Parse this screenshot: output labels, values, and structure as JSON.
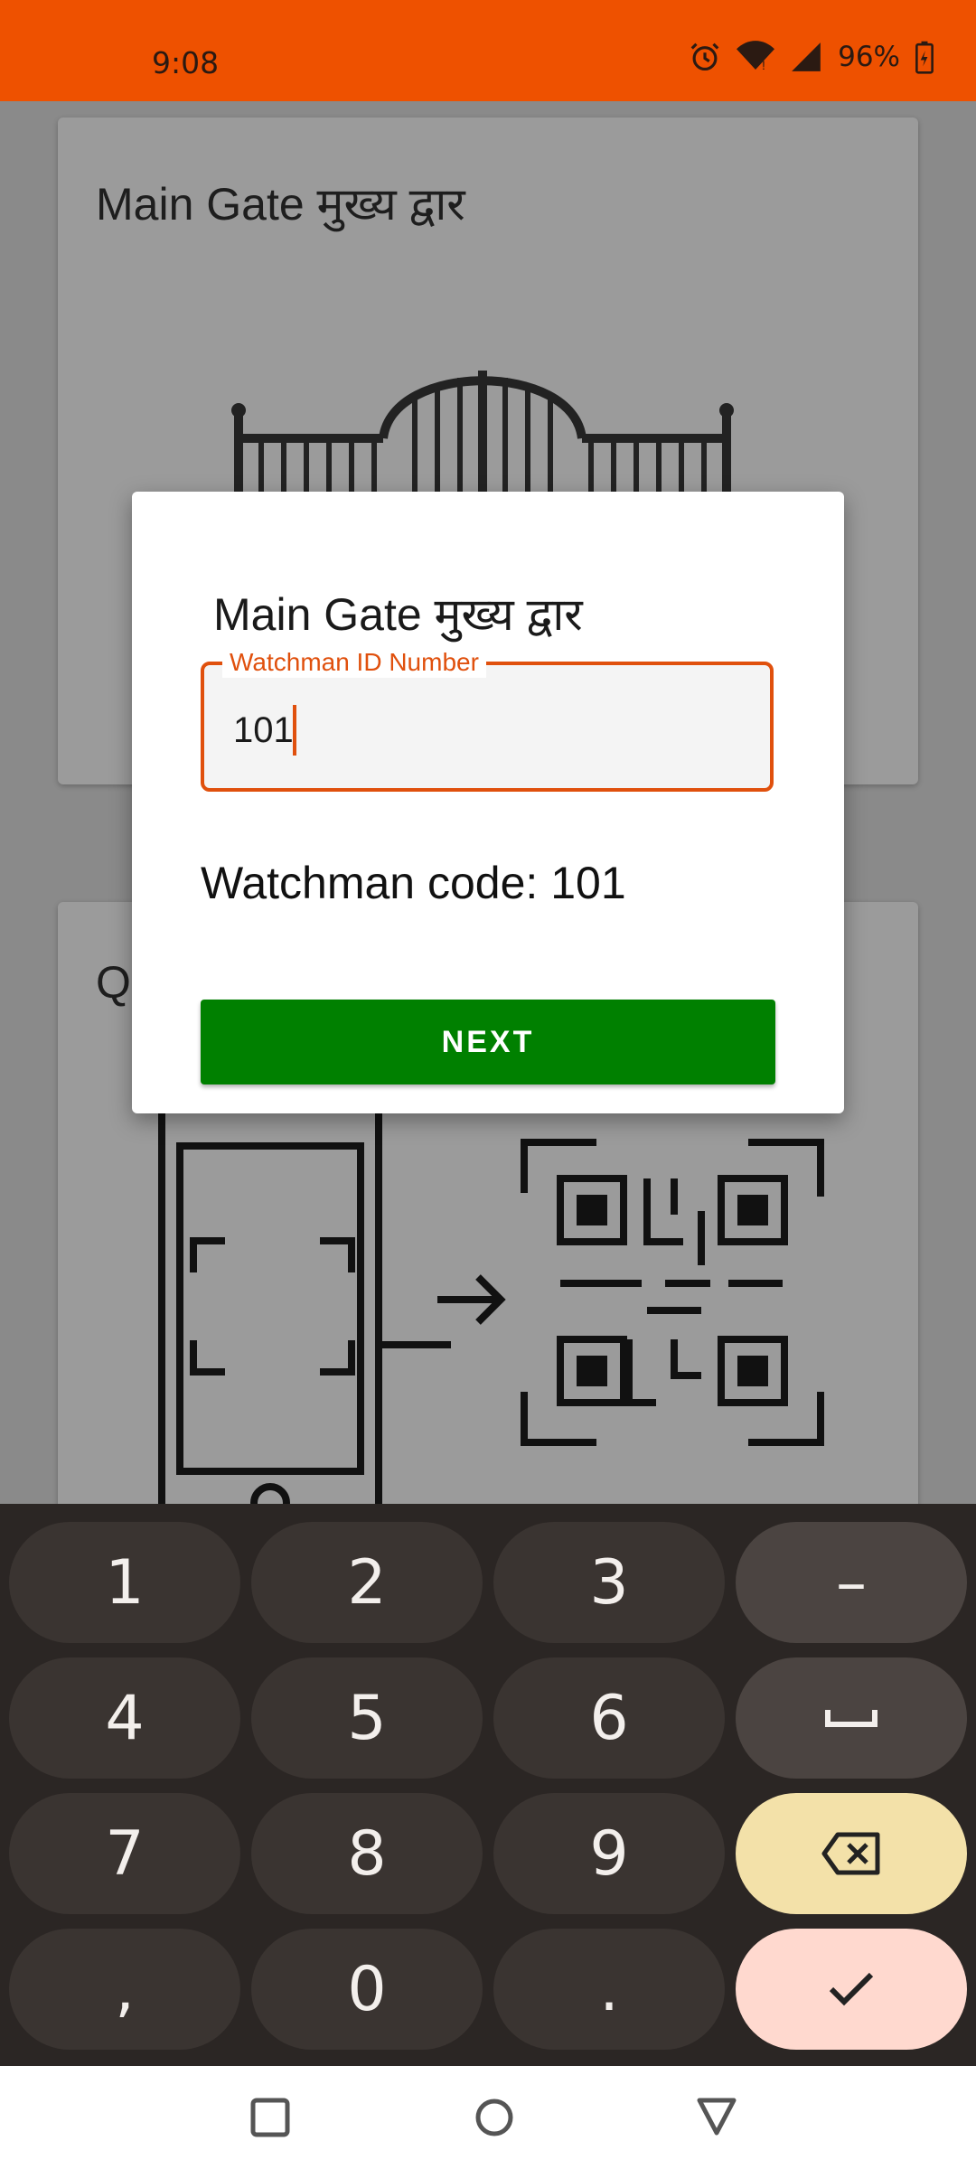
{
  "status_bar": {
    "time": "9:08",
    "battery": "96%"
  },
  "background": {
    "card1_title": "Main Gate   मुख्य द्वार",
    "card2_title": "Q"
  },
  "dialog": {
    "title": "Main Gate    मुख्य द्वार",
    "field_label": "Watchman ID Number",
    "field_value": "101",
    "code_text": "Watchman code: 101",
    "next_label": "NEXT"
  },
  "keyboard": {
    "keys": [
      "1",
      "2",
      "3",
      "–",
      "4",
      "5",
      "6",
      "␣",
      "7",
      "8",
      "9",
      "⌫",
      ",",
      "0",
      ".",
      "✓"
    ],
    "space_icon": "space-icon",
    "backspace_icon": "backspace-icon",
    "done_icon": "check-icon"
  },
  "colors": {
    "status_bar": "#ee5100",
    "accent": "#e0500d",
    "next_button": "#008000"
  }
}
